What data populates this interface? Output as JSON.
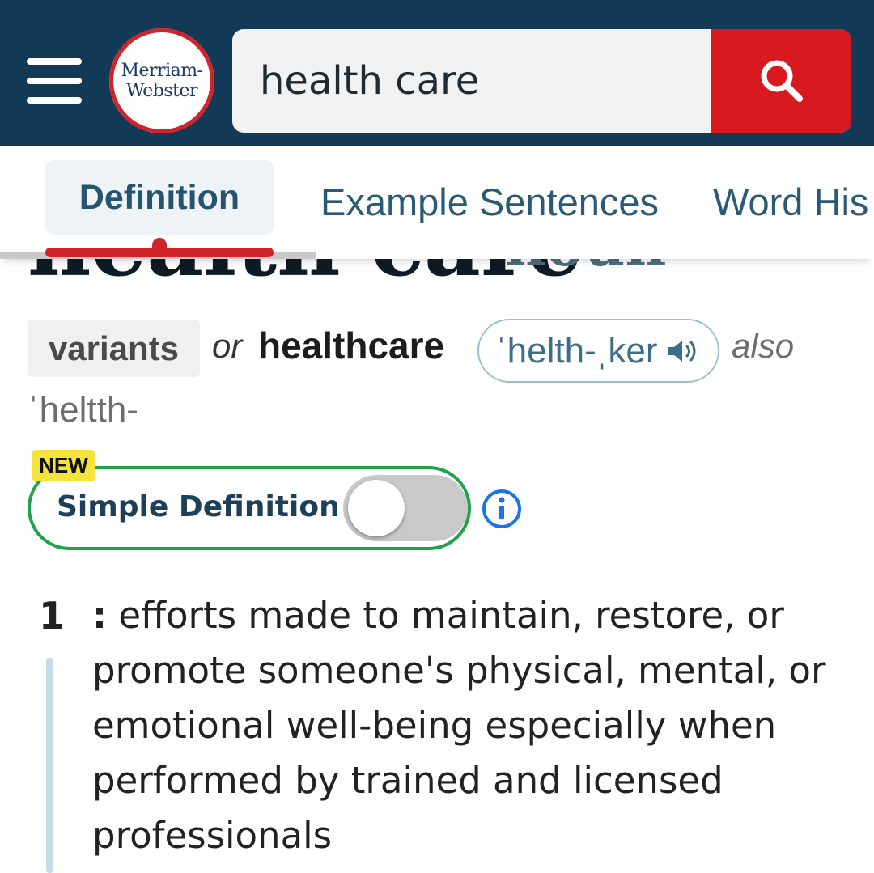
{
  "header": {
    "logo": {
      "line1": "Merriam-",
      "line2": "Webster"
    },
    "search": {
      "value": "health care"
    }
  },
  "tabs": {
    "active": "Definition",
    "items": [
      "Example Sentences",
      "Word His"
    ]
  },
  "entry": {
    "headword": "health care",
    "part_of_speech": "noun",
    "variants_label": "variants",
    "or": "or",
    "variant_word": "healthcare",
    "pronunciation": "ˈhelth-ˌker",
    "also": "also",
    "pronunciation_alt": "ˈheltth-"
  },
  "simple_definition": {
    "badge": "NEW",
    "label": "Simple Definition",
    "enabled": false
  },
  "senses": [
    {
      "number": "1",
      "colon": ":",
      "text": "efforts made to maintain, restore, or promote someone's physical, mental, or emotional well-being especially when performed by trained and licensed professionals"
    }
  ],
  "colors": {
    "header_bg": "#123a56",
    "search_button": "#d71920",
    "accent_red": "#d0232a",
    "toggle_border": "#20a14a",
    "new_badge": "#f5e33d",
    "link_blue": "#2b5a75",
    "info_blue": "#1a73e8"
  },
  "icons": [
    "menu-icon",
    "search-icon",
    "speaker-icon",
    "info-icon"
  ]
}
